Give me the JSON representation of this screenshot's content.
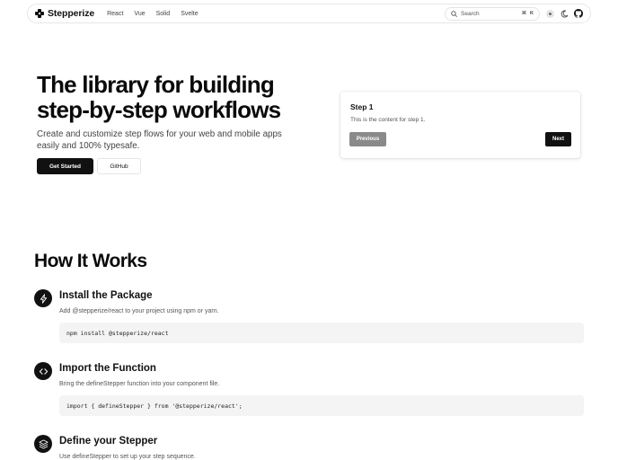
{
  "nav": {
    "brand": "Stepperize",
    "links": [
      "React",
      "Vue",
      "Solid",
      "Svelte"
    ],
    "search_placeholder": "Search",
    "shortcut_mod": "⌘",
    "shortcut_key": "K"
  },
  "hero": {
    "title_line1": "The library for building",
    "title_line2": "step-by-step workflows",
    "subtitle": "Create and customize step flows for your web and mobile apps easily and 100% typesafe.",
    "primary_button": "Get Started",
    "secondary_button": "GitHub"
  },
  "demo_card": {
    "title": "Step 1",
    "content": "This is the content for step 1.",
    "previous_label": "Previous",
    "next_label": "Next"
  },
  "how_it_works": {
    "title": "How It Works",
    "steps": [
      {
        "icon": "lightning-icon",
        "title": "Install the Package",
        "description": "Add @stepperize/react to your project using npm or yarn.",
        "code": "npm install @stepperize/react"
      },
      {
        "icon": "code-brackets-icon",
        "title": "Import the Function",
        "description": "Bring the defineStepper function into your component file.",
        "code": "import { defineStepper } from '@stepperize/react';"
      },
      {
        "icon": "layers-icon",
        "title": "Define your Stepper",
        "description": "Use defineStepper to set up your step sequence."
      }
    ]
  },
  "colors": {
    "primary": "#111111",
    "disabled_button": "#8a8a8a",
    "code_bg": "#f4f4f4"
  }
}
